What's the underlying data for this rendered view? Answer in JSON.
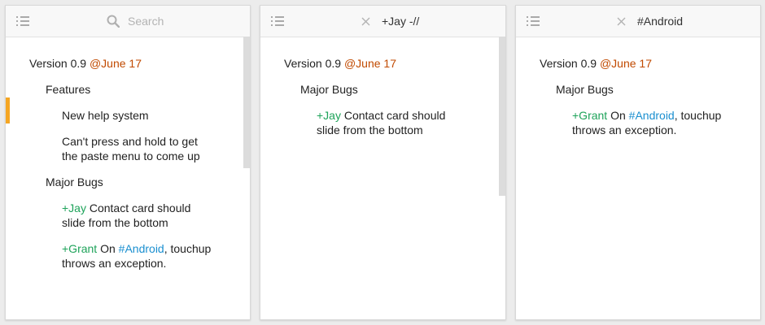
{
  "colors": {
    "accent": "#f5a623",
    "date": "#c14a00",
    "person": "#1ea35a",
    "tag": "#1a8fd0"
  },
  "panels": [
    {
      "header": {
        "menu_icon": "list-icon",
        "search_icon": "search-icon",
        "search_placeholder": "Search"
      },
      "version": {
        "label": "Version 0.9",
        "date": "@June 17"
      },
      "features": {
        "heading": "Features",
        "items": [
          {
            "lines": [
              "New help system"
            ]
          },
          {
            "lines": [
              "Can't press and hold to get",
              "the paste menu to come up"
            ]
          }
        ]
      },
      "major_bugs": {
        "heading": "Major Bugs",
        "items": [
          {
            "person": "+Jay",
            "text1": " Contact card should",
            "line2": "slide from the bottom"
          },
          {
            "person": "+Grant",
            "text_pre": " On ",
            "tag": "#Android",
            "text_post": ", touchup",
            "line2": "throws an exception."
          }
        ]
      }
    },
    {
      "header": {
        "menu_icon": "list-icon",
        "clear_icon": "close-icon",
        "query": "+Jay -//"
      },
      "version": {
        "label": "Version 0.9",
        "date": "@June 17"
      },
      "major_bugs": {
        "heading": "Major Bugs",
        "items": [
          {
            "person": "+Jay",
            "text1": " Contact card should",
            "line2": "slide from the bottom"
          }
        ]
      }
    },
    {
      "header": {
        "menu_icon": "list-icon",
        "clear_icon": "close-icon",
        "query": "#Android"
      },
      "version": {
        "label": "Version 0.9",
        "date": "@June 17"
      },
      "major_bugs": {
        "heading": "Major Bugs",
        "items": [
          {
            "person": "+Grant",
            "text_pre": " On ",
            "tag": "#Android",
            "text_post": ", touchup",
            "line2": "throws an exception."
          }
        ]
      }
    }
  ]
}
